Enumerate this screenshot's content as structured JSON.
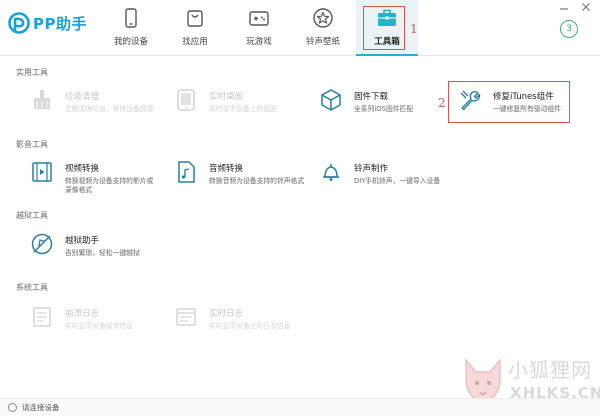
{
  "app": {
    "title": "PP助手"
  },
  "nav": {
    "items": [
      {
        "label": "我的设备",
        "icon": "phone-icon"
      },
      {
        "label": "找应用",
        "icon": "bag-icon"
      },
      {
        "label": "玩游戏",
        "icon": "gamepad-icon"
      },
      {
        "label": "铃声壁纸",
        "icon": "star-icon"
      },
      {
        "label": "工具箱",
        "icon": "toolbox-icon",
        "active": true
      }
    ]
  },
  "annotations": {
    "marker1": "1",
    "marker2": "2"
  },
  "update_badge": "3",
  "sections": {
    "practical": "实用工具",
    "media": "影音工具",
    "jailbreak": "越狱工具",
    "system": "系统工具"
  },
  "tools": {
    "junk_clean": {
      "name": "垃圾清理",
      "desc": "定期清理垃圾，保持设备健康",
      "enabled": false
    },
    "live_desktop": {
      "name": "实时桌面",
      "desc": "实时显示设备上的画面",
      "enabled": false
    },
    "firmware": {
      "name": "固件下载",
      "desc": "全系列iOS固件匹配",
      "enabled": true
    },
    "itunes_repair": {
      "name": "修复iTunes组件",
      "desc": "一键修复所有驱动组件",
      "enabled": true
    },
    "video_convert": {
      "name": "视频转换",
      "desc": "转换视频为设备支持的影片或录像格式",
      "enabled": true
    },
    "audio_convert": {
      "name": "音频转换",
      "desc": "转换音频为设备支持的铃声格式",
      "enabled": true
    },
    "ringtone": {
      "name": "铃声制作",
      "desc": "DIY手机铃声，一键导入设备",
      "enabled": true
    },
    "jailbreak_helper": {
      "name": "越狱助手",
      "desc": "告别繁琐，轻松一键越狱",
      "enabled": true
    },
    "crash_log": {
      "name": "崩溃日志",
      "desc": "实时显示设备崩溃信息",
      "enabled": false
    },
    "realtime_log": {
      "name": "实时日志",
      "desc": "实时显示设备上的日志信息",
      "enabled": false
    }
  },
  "status": {
    "text": "请连接设备"
  },
  "watermark": {
    "line1": "小狐狸网",
    "line2": "XHLKS.CN"
  },
  "colors": {
    "brand": "#18a0d8",
    "active_tab_bg": "#eaf4f7",
    "toolbox_icon": "#26b3c9",
    "annotation_red": "#d9534f",
    "enabled_icon": "#2a7f9e",
    "disabled_icon": "#d0d0d0"
  }
}
